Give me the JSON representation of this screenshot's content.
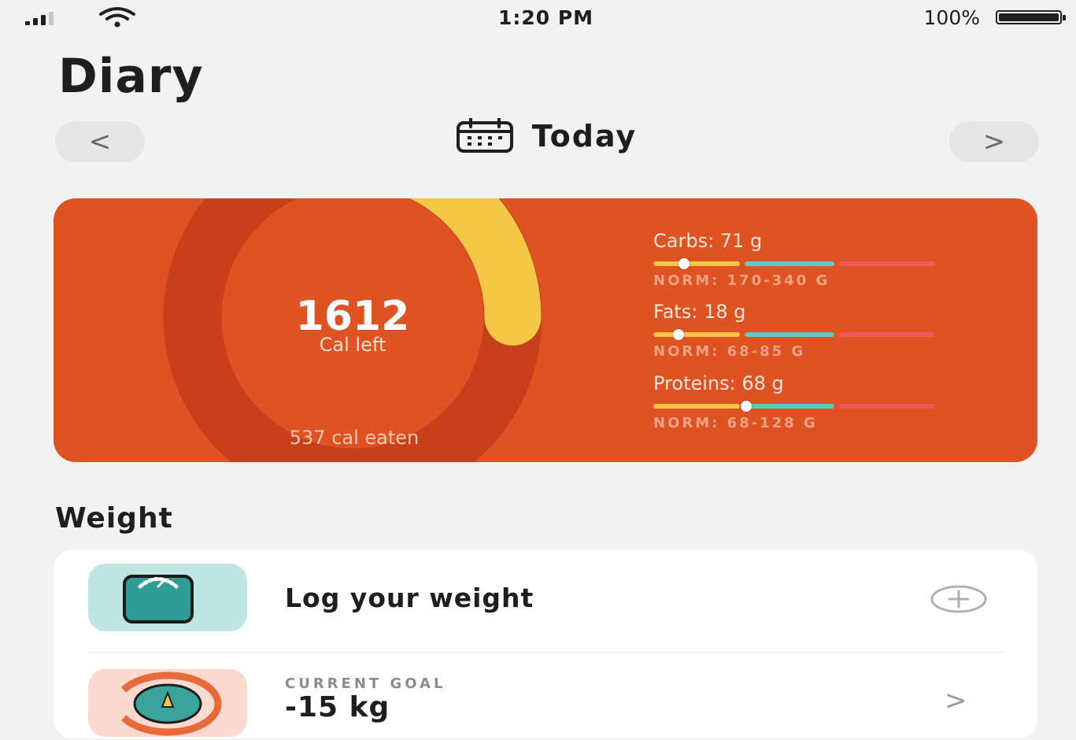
{
  "status_bar": {
    "time": "1:20 PM",
    "battery": "100%"
  },
  "page": {
    "title": "Diary"
  },
  "date_nav": {
    "prev": "<",
    "label": "Today",
    "next": ">"
  },
  "calories": {
    "left": "1612",
    "left_label": "Cal left",
    "eaten": "537 cal eaten",
    "ring_progress": 0.25
  },
  "macros": [
    {
      "label": "Carbs: 71 g",
      "norm": "NORM: 170-340 G",
      "level": 0.11
    },
    {
      "label": "Fats: 18 g",
      "norm": "NORM: 68-85 G",
      "level": 0.09
    },
    {
      "label": "Proteins: 68 g",
      "norm": "NORM: 68-128 G",
      "level": 0.33
    }
  ],
  "weight": {
    "title": "Weight",
    "log_label": "Log your weight",
    "goal_kicker": "CURRENT GOAL",
    "goal_value": "-15 kg",
    "chevron": ">"
  },
  "colors": {
    "card": "#df5222",
    "ring_track": "#c7401b",
    "ring_progress": "#f6c744",
    "scale_tile": "#bfe6e2",
    "goal_tile": "#fbd9cf"
  },
  "icons": [
    "signal-icon",
    "wifi-icon",
    "battery-icon",
    "calendar-icon",
    "flame-icon",
    "scale-icon",
    "plus-circle-icon",
    "goal-icon"
  ]
}
